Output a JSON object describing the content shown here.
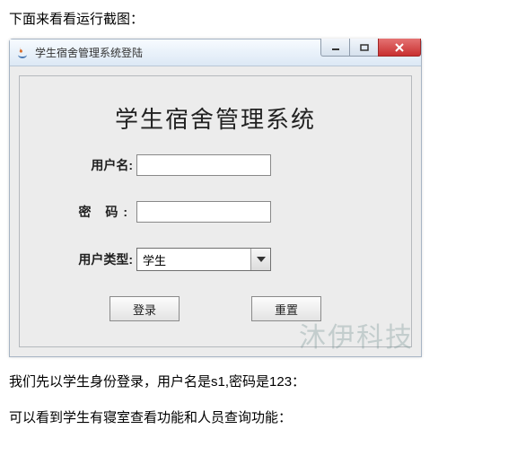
{
  "page": {
    "intro_text": "下面来看看运行截图：",
    "footer_text_1": "我们先以学生身份登录，用户名是s1,密码是123：",
    "footer_text_2": "可以看到学生有寝室查看功能和人员查询功能：",
    "watermark": "沐伊科技"
  },
  "window": {
    "title": "学生宿舍管理系统登陆"
  },
  "form": {
    "heading": "学生宿舍管理系统",
    "username_label": "用户名:",
    "username_value": "",
    "password_label": "密 码:",
    "password_value": "",
    "usertype_label": "用户类型:",
    "usertype_selected": "学生",
    "login_button": "登录",
    "reset_button": "重置"
  }
}
